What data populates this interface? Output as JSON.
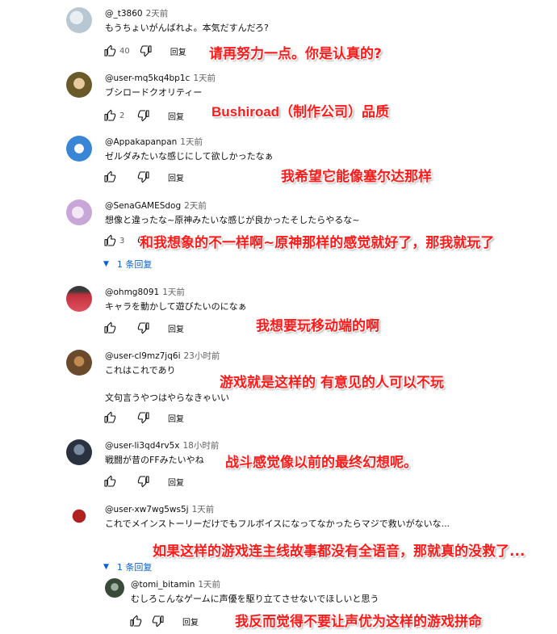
{
  "comments": [
    {
      "author": "@_t3860",
      "time": "2天前",
      "text": "もうちょいがんばれよ。本気だすんだろ?",
      "likes": "40",
      "reply_label": "回复",
      "avatar_color": "#b9c7d2",
      "translation": "请再努力一点。你是认真的?"
    },
    {
      "author": "@user-mq5kq4bp1c",
      "time": "1天前",
      "text": "ブシロードクオリティー",
      "likes": "2",
      "reply_label": "回复",
      "avatar_color": "#7d6b3a",
      "translation_latin": "Bushiroad",
      "translation_rest": "（制作公司）品质"
    },
    {
      "author": "@Appakapanpan",
      "time": "1天前",
      "text": "ゼルダみたいな感じにして欲しかったなぁ",
      "likes": "",
      "reply_label": "回复",
      "avatar_color": "#3a86d6",
      "translation": "我希望它能像塞尔达那样"
    },
    {
      "author": "@SenaGAMESdog",
      "time": "2天前",
      "text": "想像と違ったな~原神みたいな感じが良かったそしたらやるな~",
      "likes": "3",
      "reply_label": "回复",
      "avatar_color": "#c9a6d8",
      "expand_label": "1 条回复",
      "translation": "和我想象的不一样啊~原神那样的感觉就好了，那我就玩了"
    },
    {
      "author": "@ohmg8091",
      "time": "1天前",
      "text": "キャラを動かして遊びたいのになぁ",
      "likes": "",
      "reply_label": "回复",
      "avatar_color": "#c0303c",
      "translation": "我想要玩移动端的啊"
    },
    {
      "author": "@user-cl9mz7jq6i",
      "time": "23小时前",
      "text": "これはこれであり",
      "text2": "文句言うやつはやらなきゃいい",
      "likes": "",
      "reply_label": "回复",
      "avatar_color": "#6a4a2a",
      "translation": "游戏就是这样的 有意见的人可以不玩"
    },
    {
      "author": "@user-li3qd4rv5x",
      "time": "18小时前",
      "text": "戦闘が昔のFFみたいやね",
      "likes": "",
      "reply_label": "回复",
      "avatar_color": "#2a3240",
      "translation": "战斗感觉像以前的最终幻想呢。"
    },
    {
      "author": "@user-xw7wg5ws5j",
      "time": "1天前",
      "text": "これでメインストーリーだけでもフルボイスになってなかったらマジで救いがないな...",
      "likes": "",
      "reply_label": "回复",
      "avatar_color": "#b02020",
      "expand_label": "1 条回复",
      "translation": "如果这样的游戏连主线故事都没有全语音，那就真的没救了..."
    }
  ],
  "reply": {
    "author": "@tomi_bitamin",
    "time": "1天前",
    "text": "むしろこんなゲームに声優を駆り立てさせないでほしいと思う",
    "reply_label": "回复",
    "avatar_color": "#3a4a3a",
    "translation": "我反而觉得不要让声优为这样的游戏拼命"
  },
  "icons": {
    "like": "thumbs-up-icon",
    "dislike": "thumbs-down-icon",
    "expand": "chevron-down-icon"
  },
  "colors": {
    "link_blue": "#065fd4",
    "overlay_red": "#ff1a1a",
    "meta_gray": "#606060"
  }
}
